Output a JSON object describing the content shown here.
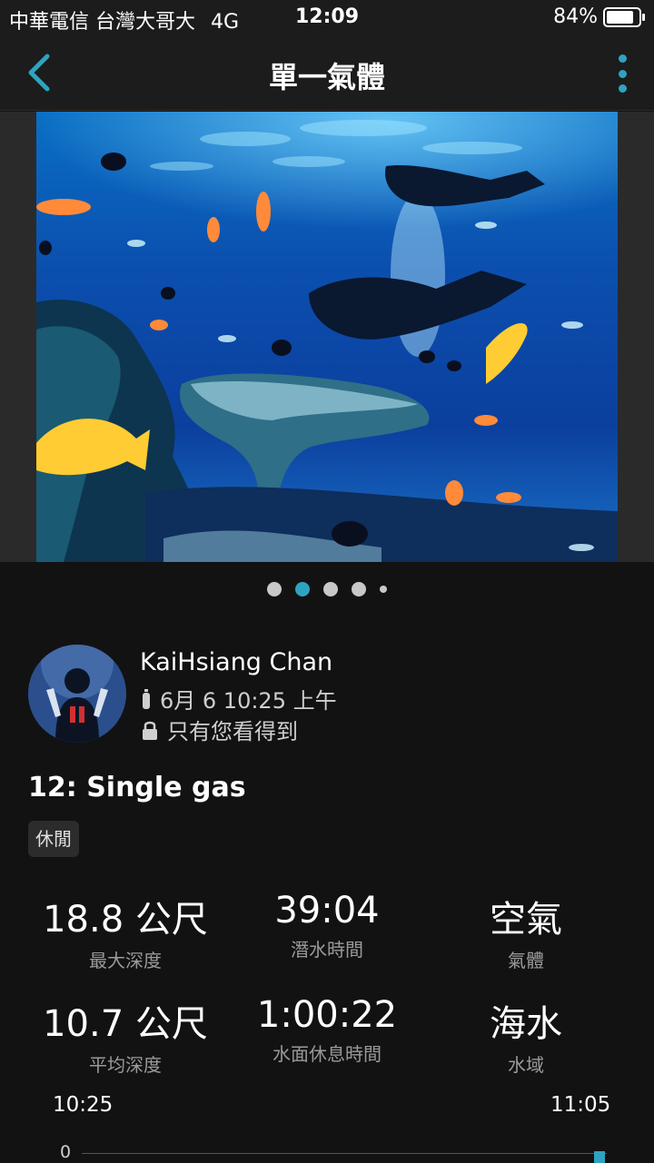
{
  "status_bar": {
    "carrier": "中華電信 台灣大哥大",
    "network": "4G",
    "time": "12:09",
    "battery": "84%",
    "battery_level": 0.84
  },
  "header": {
    "title": "單一氣體",
    "back_icon": "chevron-left-icon",
    "menu_icon": "more-vertical-icon"
  },
  "gallery": {
    "dot_count": 5,
    "active_index": 1
  },
  "profile": {
    "name": "KaiHsiang Chan",
    "date": "6月 6 10:25 上午",
    "privacy": "只有您看得到",
    "date_icon": "tank-icon",
    "privacy_icon": "lock-icon"
  },
  "dive": {
    "title": "12: Single gas",
    "tag": "休閒"
  },
  "stats": [
    {
      "value": "18.8 公尺",
      "label": "最大深度"
    },
    {
      "value": "39:04",
      "label": "潛水時間"
    },
    {
      "value": "空氣",
      "label": "氣體"
    },
    {
      "value": "10.7 公尺",
      "label": "平均深度"
    },
    {
      "value": "1:00:22",
      "label": "水面休息時間"
    },
    {
      "value": "海水",
      "label": "水域"
    }
  ],
  "chart": {
    "start_time": "10:25",
    "end_time": "11:05",
    "y_tick": "0"
  },
  "colors": {
    "accent": "#2ea3c0",
    "background": "#121212",
    "header_bg": "#1c1c1c"
  }
}
